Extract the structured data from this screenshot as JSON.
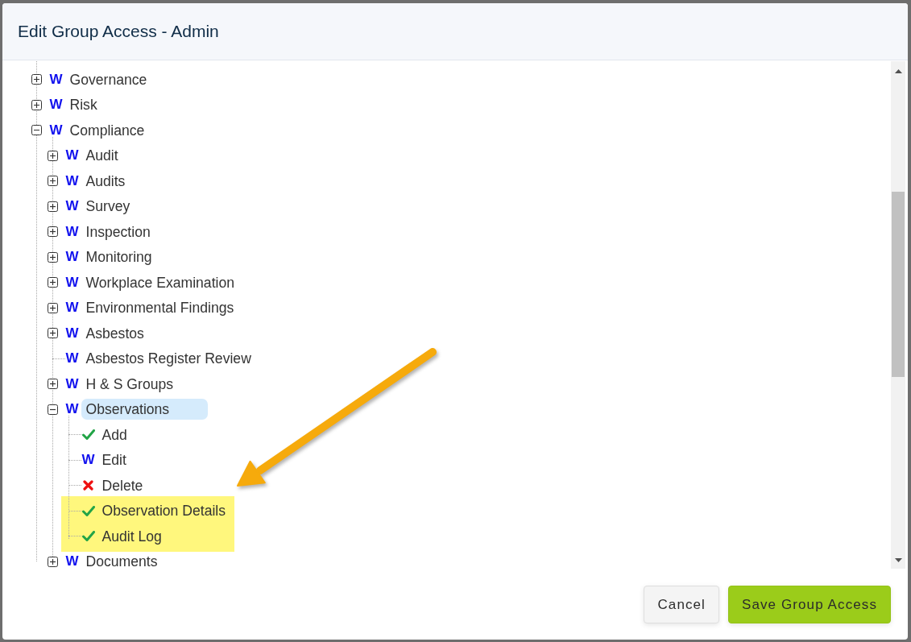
{
  "dialog": {
    "title": "Edit Group Access - Admin"
  },
  "tree": [
    {
      "label": "Governance",
      "kind": "write",
      "mark": "W",
      "expanded": false,
      "selected": false,
      "highlighted": false
    },
    {
      "label": "Risk",
      "kind": "write",
      "mark": "W",
      "expanded": false,
      "selected": false,
      "highlighted": false
    },
    {
      "label": "Compliance",
      "kind": "write",
      "mark": "W",
      "expanded": true,
      "selected": false,
      "highlighted": false,
      "children": [
        {
          "label": "Audit",
          "kind": "write",
          "mark": "W",
          "expanded": false,
          "selected": false,
          "highlighted": false
        },
        {
          "label": "Audits",
          "kind": "write",
          "mark": "W",
          "expanded": false,
          "selected": false,
          "highlighted": false
        },
        {
          "label": "Survey",
          "kind": "write",
          "mark": "W",
          "expanded": false,
          "selected": false,
          "highlighted": false
        },
        {
          "label": "Inspection",
          "kind": "write",
          "mark": "W",
          "expanded": false,
          "selected": false,
          "highlighted": false
        },
        {
          "label": "Monitoring",
          "kind": "write",
          "mark": "W",
          "expanded": false,
          "selected": false,
          "highlighted": false
        },
        {
          "label": "Workplace Examination",
          "kind": "write",
          "mark": "W",
          "expanded": false,
          "selected": false,
          "highlighted": false
        },
        {
          "label": "Environmental Findings",
          "kind": "write",
          "mark": "W",
          "expanded": false,
          "selected": false,
          "highlighted": false
        },
        {
          "label": "Asbestos",
          "kind": "write",
          "mark": "W",
          "expanded": false,
          "selected": false,
          "highlighted": false
        },
        {
          "label": "Asbestos Register Review",
          "kind": "write",
          "mark": "W",
          "selected": false,
          "highlighted": false
        },
        {
          "label": "H & S Groups",
          "kind": "write",
          "mark": "W",
          "expanded": false,
          "selected": false,
          "highlighted": false
        },
        {
          "label": "Observations",
          "kind": "write",
          "mark": "W",
          "expanded": true,
          "selected": true,
          "highlighted": false,
          "children": [
            {
              "label": "Add",
              "kind": "granted",
              "selected": false,
              "highlighted": false
            },
            {
              "label": "Edit",
              "kind": "write",
              "mark": "W",
              "selected": false,
              "highlighted": false
            },
            {
              "label": "Delete",
              "kind": "denied",
              "selected": false,
              "highlighted": false
            },
            {
              "label": "Observation Details",
              "kind": "granted",
              "selected": false,
              "highlighted": true
            },
            {
              "label": "Audit Log",
              "kind": "granted",
              "selected": false,
              "highlighted": true
            }
          ]
        },
        {
          "label": "Documents",
          "kind": "write",
          "mark": "W",
          "expanded": false,
          "selected": false,
          "highlighted": false
        }
      ]
    }
  ],
  "buttons": [
    {
      "label": "Cancel",
      "kind": "cancel"
    },
    {
      "label": "Save Group Access",
      "kind": "submit"
    }
  ],
  "annotations": {
    "arrow": true
  }
}
